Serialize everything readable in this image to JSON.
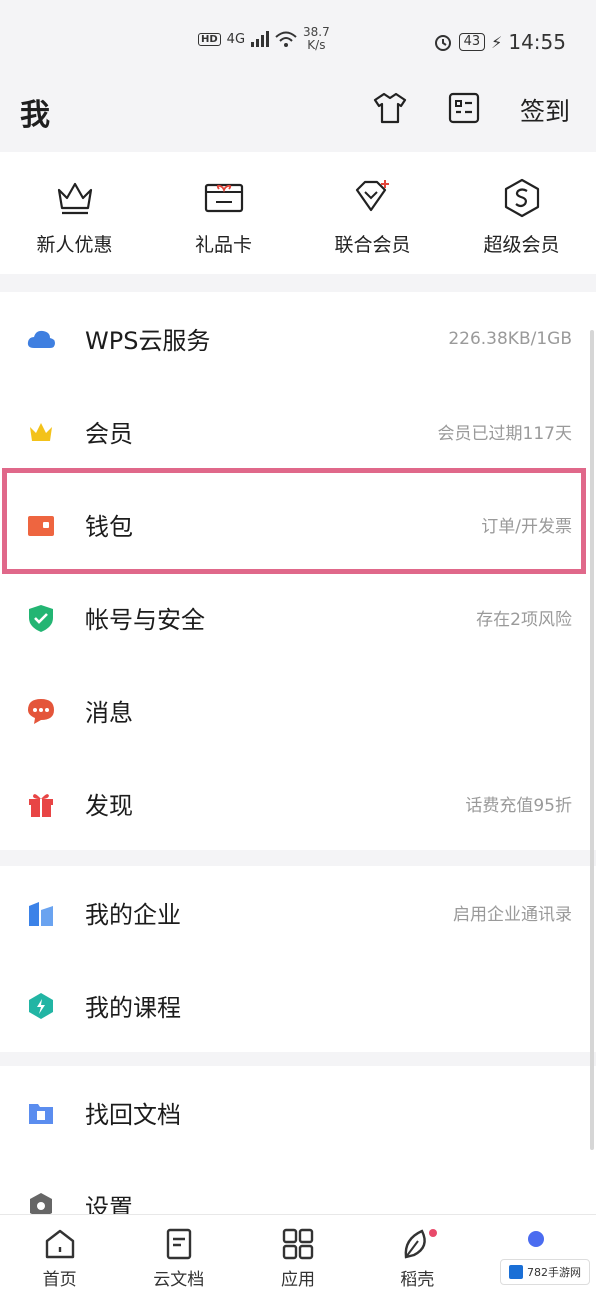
{
  "status_bar": {
    "hd": "HD",
    "network": "4G",
    "speed_value": "38.7",
    "speed_unit": "K/s",
    "battery": "43",
    "time": "14:55"
  },
  "header": {
    "title": "我",
    "sign_in": "签到"
  },
  "quick_actions": [
    {
      "label": "新人优惠",
      "icon": "crown-outline-icon"
    },
    {
      "label": "礼品卡",
      "icon": "gift-card-icon"
    },
    {
      "label": "联合会员",
      "icon": "diamond-plus-icon"
    },
    {
      "label": "超级会员",
      "icon": "super-member-icon"
    }
  ],
  "menu_group_1": [
    {
      "label": "WPS云服务",
      "extra": "226.38KB/1GB",
      "icon": "cloud-icon",
      "color": "#3f7fe0"
    },
    {
      "label": "会员",
      "extra": "会员已过期117天",
      "icon": "crown-icon",
      "color": "#f3c21a"
    },
    {
      "label": "钱包",
      "extra": "订单/开发票",
      "icon": "wallet-icon",
      "color": "#ee6540"
    },
    {
      "label": "帐号与安全",
      "extra": "存在2项风险",
      "icon": "shield-icon",
      "color": "#23b573"
    },
    {
      "label": "消息",
      "extra": "",
      "icon": "message-icon",
      "color": "#e4553a"
    },
    {
      "label": "发现",
      "extra": "话费充值95折",
      "icon": "gift-icon",
      "color": "#e84545"
    }
  ],
  "menu_group_2": [
    {
      "label": "我的企业",
      "extra": "启用企业通讯录",
      "icon": "enterprise-icon",
      "color": "#3b82e8"
    },
    {
      "label": "我的课程",
      "extra": "",
      "icon": "course-icon",
      "color": "#22b5a4"
    }
  ],
  "menu_group_3": [
    {
      "label": "找回文档",
      "extra": "",
      "icon": "recover-doc-icon",
      "color": "#5b8def"
    },
    {
      "label": "设置",
      "extra": "",
      "icon": "settings-icon",
      "color": "#666666"
    }
  ],
  "tabs": [
    {
      "label": "首页",
      "icon": "home-icon"
    },
    {
      "label": "云文档",
      "icon": "document-icon"
    },
    {
      "label": "应用",
      "icon": "apps-icon"
    },
    {
      "label": "稻壳",
      "icon": "leaf-icon"
    },
    {
      "label": "",
      "icon": "profile-icon"
    }
  ],
  "watermark": "782手游网"
}
